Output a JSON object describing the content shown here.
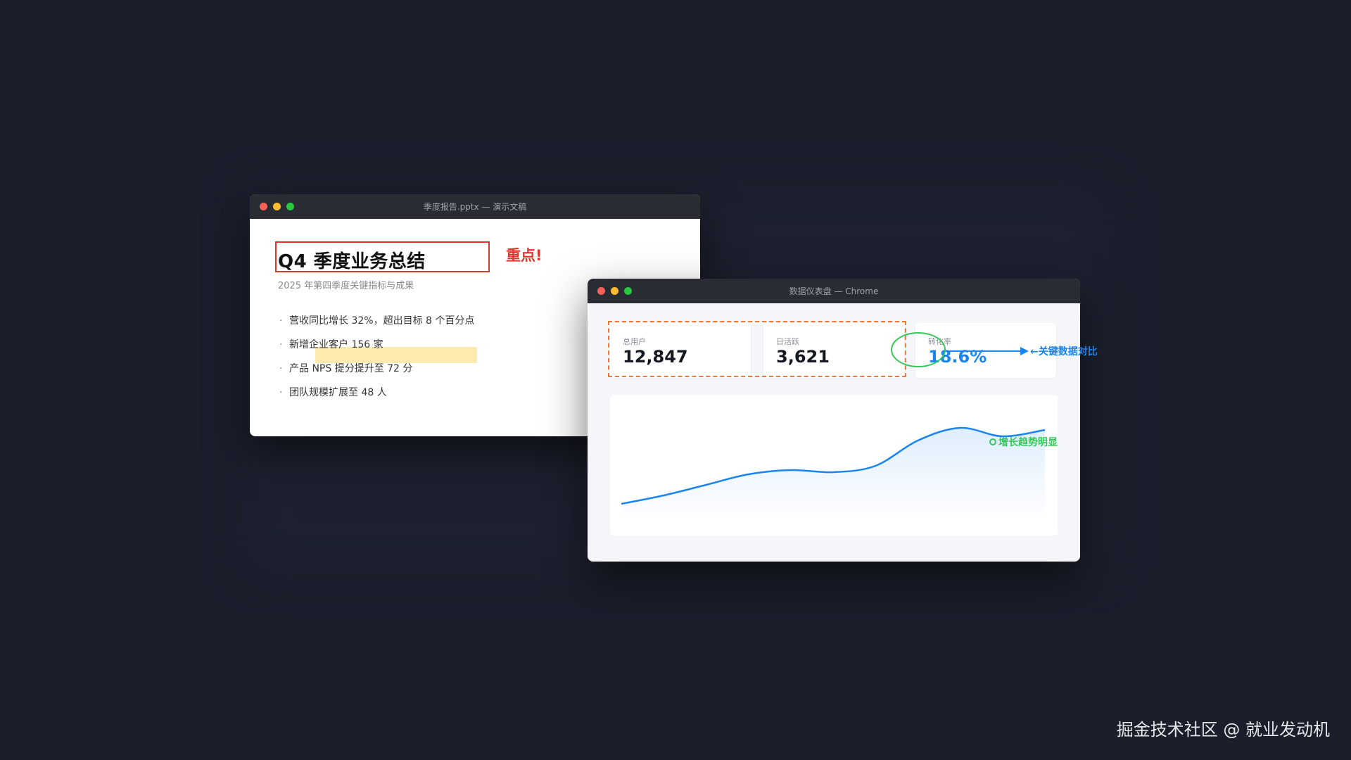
{
  "ppt_window": {
    "title": "季度报告.pptx — 演示文稿",
    "slide": {
      "title": "Q4 季度业务总结",
      "subtitle": "2025 年第四季度关键指标与成果",
      "emphasis_note": "重点!",
      "bullets": [
        "营收同比增长 32%，超出目标 8 个百分点",
        "新增企业客户 156 家",
        "产品 NPS 提分提升至 72 分",
        "团队规模扩展至 48 人"
      ]
    }
  },
  "dashboard_window": {
    "title": "数据仪表盘 — Chrome",
    "cards": [
      {
        "label": "总用户",
        "value": "12,847"
      },
      {
        "label": "日活跃",
        "value": "3,621"
      },
      {
        "label": "转化率",
        "value": "18.6%"
      }
    ],
    "accent_color": "#1a84f0"
  },
  "annotations": {
    "arrow_label": "←关键数据对比",
    "trend_label": "增长趋势明显"
  },
  "chart_data": {
    "type": "area",
    "x": [
      0,
      1,
      2,
      3,
      4,
      5,
      6,
      7,
      8,
      9,
      10
    ],
    "series": [
      {
        "values": [
          10,
          18,
          28,
          38,
          42,
          40,
          46,
          70,
          82,
          74,
          80
        ]
      }
    ],
    "ylim": [
      0,
      100
    ],
    "color": "#1a84f0"
  },
  "watermark": "掘金技术社区 @ 就业发动机",
  "colors": {
    "background": "#1b1e2b",
    "annotation_red": "#e0362c",
    "annotation_orange": "#ea7a3a",
    "annotation_green": "#35c759",
    "annotation_blue": "#1a84f0",
    "highlight_yellow": "#fce8a6"
  }
}
